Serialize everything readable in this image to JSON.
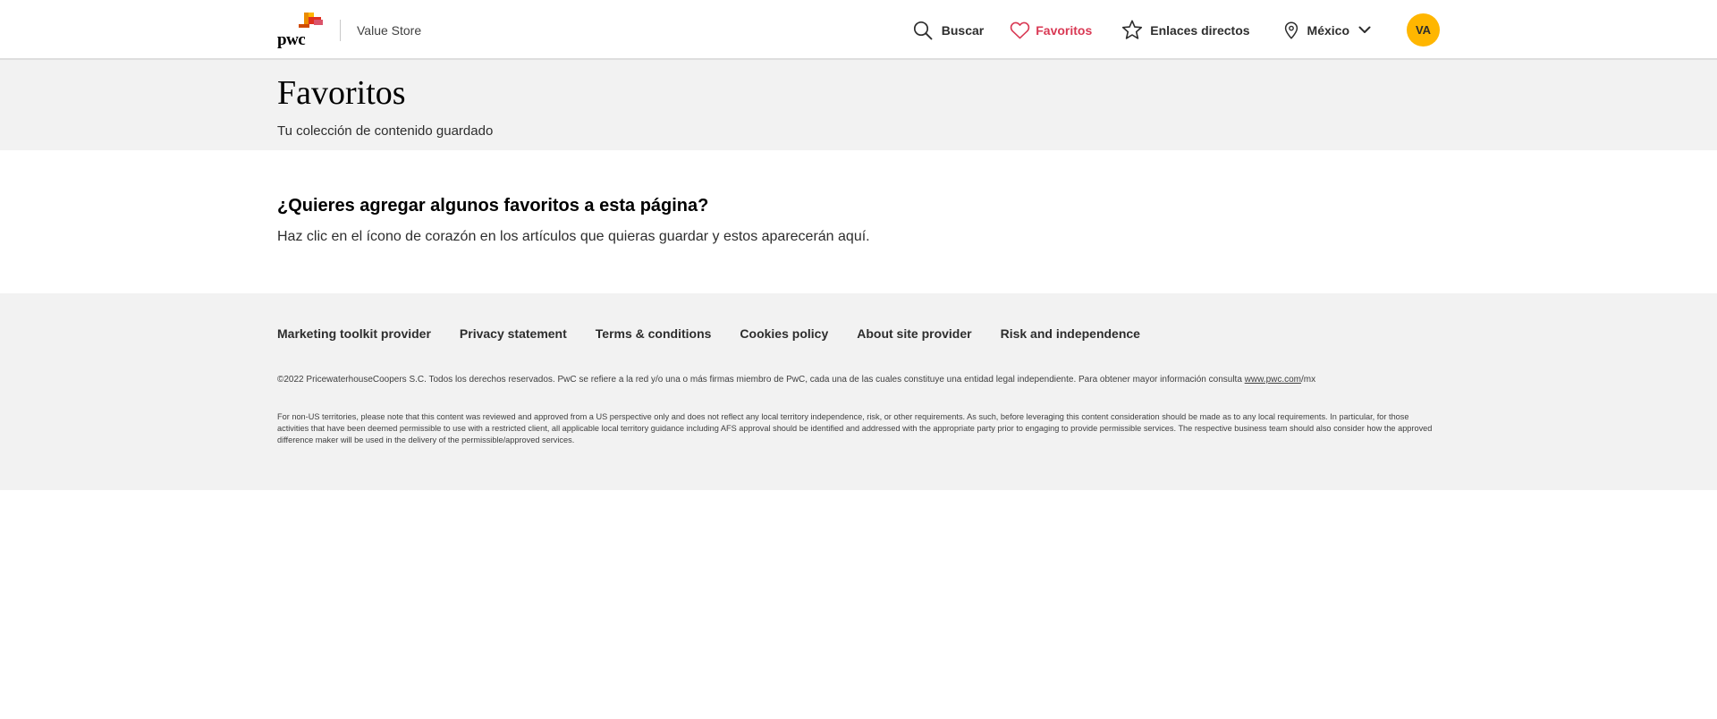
{
  "header": {
    "logo_text": "pwc",
    "site_name": "Value Store",
    "nav": {
      "search": "Buscar",
      "favorites": "Favoritos",
      "direct_links": "Enlaces directos",
      "country": "México"
    },
    "avatar_initials": "VA"
  },
  "title_band": {
    "title": "Favoritos",
    "subtitle": "Tu colección de contenido guardado"
  },
  "main": {
    "heading": "¿Quieres agregar algunos favoritos a esta página?",
    "text": "Haz clic en el ícono de corazón en los artículos que quieras guardar y estos aparecerán aquí."
  },
  "footer": {
    "links": [
      "Marketing toolkit provider",
      "Privacy statement",
      "Terms & conditions",
      "Cookies policy",
      "About site provider",
      "Risk and independence"
    ],
    "copyright": "©2022 PricewaterhouseCoopers S.C. Todos los derechos reservados. PwC se refiere a la red y/o una o más firmas miembro de PwC, cada una de las cuales constituye una entidad legal independiente. Para obtener mayor información consulta ",
    "copyright_link": "www.pwc.com",
    "copyright_suffix": "/mx",
    "disclaimer": "For non-US territories, please note that this content was reviewed and approved from a US perspective only and does not reflect any local territory independence, risk, or other requirements. As such, before leveraging this content consideration should be made as to any local requirements. In particular, for those activities that have been deemed permissible to use with a restricted client, all applicable local territory guidance including AFS approval should be identified and addressed with the appropriate party prior to engaging to provide permissible services. The respective business team should also consider how the approved difference maker will be used in the delivery of the permissible/approved services."
  },
  "colors": {
    "accent_favorites": "#d93954",
    "avatar_bg": "#ffb600",
    "band_bg": "#f2f2f2"
  },
  "icons": {
    "search": "search-icon",
    "favorites": "heart-icon",
    "direct_links": "star-icon",
    "country": "location-pin-icon",
    "dropdown": "chevron-down-icon"
  }
}
